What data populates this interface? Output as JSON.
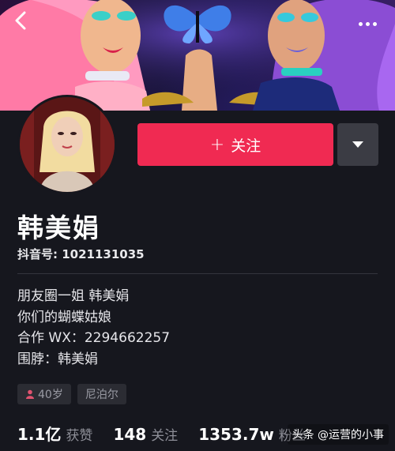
{
  "profile": {
    "name": "韩美娟",
    "douyin_id": "抖音号: 1021131035",
    "follow_label": "关注",
    "bio_lines": [
      "朋友圈一姐 韩美娟",
      "你们的蝴蝶姑娘",
      "合作 WX：2294662257",
      "围脖：韩美娟"
    ],
    "tags": [
      "40岁",
      "尼泊尔"
    ]
  },
  "stats": [
    {
      "value": "1.1亿",
      "label": "获赞"
    },
    {
      "value": "148",
      "label": "关注"
    },
    {
      "value": "1353.7w",
      "label": "粉丝"
    }
  ],
  "watermark": "头条 @运营的小事",
  "colors": {
    "background": "#16171e",
    "follow_button": "#f02a52",
    "dropdown_button": "#3b3c44",
    "tag_bg": "#2b2c33"
  },
  "icons": {
    "back": "chevron-left-icon",
    "more": "more-dots-icon",
    "dropdown": "caret-down-icon",
    "gender": "female-user-icon"
  }
}
